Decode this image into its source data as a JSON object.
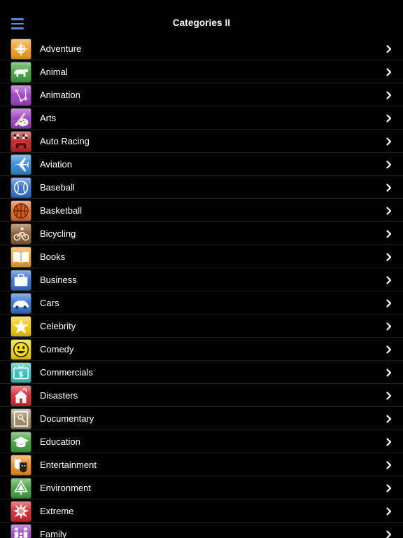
{
  "header": {
    "title": "Categories II",
    "menu_icon": "hamburger-menu-icon",
    "accent_color": "#4a8fd8"
  },
  "categories": [
    {
      "label": "Adventure",
      "icon": "compass-icon",
      "color": "#f39a1e"
    },
    {
      "label": "Animal",
      "icon": "bear-icon",
      "color": "#3fa23a"
    },
    {
      "label": "Animation",
      "icon": "animation-icon",
      "color": "#9b3fc4"
    },
    {
      "label": "Arts",
      "icon": "paint-brush-palette-icon",
      "color": "#9b3fc4"
    },
    {
      "label": "Auto Racing",
      "icon": "checkered-flags-car-icon",
      "color": "#c8201e"
    },
    {
      "label": "Aviation",
      "icon": "airplane-icon",
      "color": "#2f86d8"
    },
    {
      "label": "Baseball",
      "icon": "baseball-icon",
      "color": "#2f6fd0"
    },
    {
      "label": "Basketball",
      "icon": "basketball-icon",
      "color": "#e06a28"
    },
    {
      "label": "Bicycling",
      "icon": "bicycle-icon",
      "color": "#8a5a2a"
    },
    {
      "label": "Books",
      "icon": "open-book-icon",
      "color": "#f0a020"
    },
    {
      "label": "Business",
      "icon": "briefcase-icon",
      "color": "#2f6fd0"
    },
    {
      "label": "Cars",
      "icon": "car-icon",
      "color": "#2f6fd0"
    },
    {
      "label": "Celebrity",
      "icon": "star-icon",
      "color": "#f0c800"
    },
    {
      "label": "Comedy",
      "icon": "smiley-face-icon",
      "color": "#f0d000"
    },
    {
      "label": "Commercials",
      "icon": "tv-dollar-icon",
      "color": "#2fc0b8"
    },
    {
      "label": "Disasters",
      "icon": "burning-house-icon",
      "color": "#d8242a"
    },
    {
      "label": "Documentary",
      "icon": "documentary-frame-icon",
      "color": "#a08860"
    },
    {
      "label": "Education",
      "icon": "graduation-cap-icon",
      "color": "#3fa23a"
    },
    {
      "label": "Entertainment",
      "icon": "theater-masks-icon",
      "color": "#f08a1e"
    },
    {
      "label": "Environment",
      "icon": "recycle-tree-icon",
      "color": "#3fa23a"
    },
    {
      "label": "Extreme",
      "icon": "explosion-icon",
      "color": "#d8242a"
    },
    {
      "label": "Family",
      "icon": "family-icon",
      "color": "#9b3fc4"
    }
  ]
}
